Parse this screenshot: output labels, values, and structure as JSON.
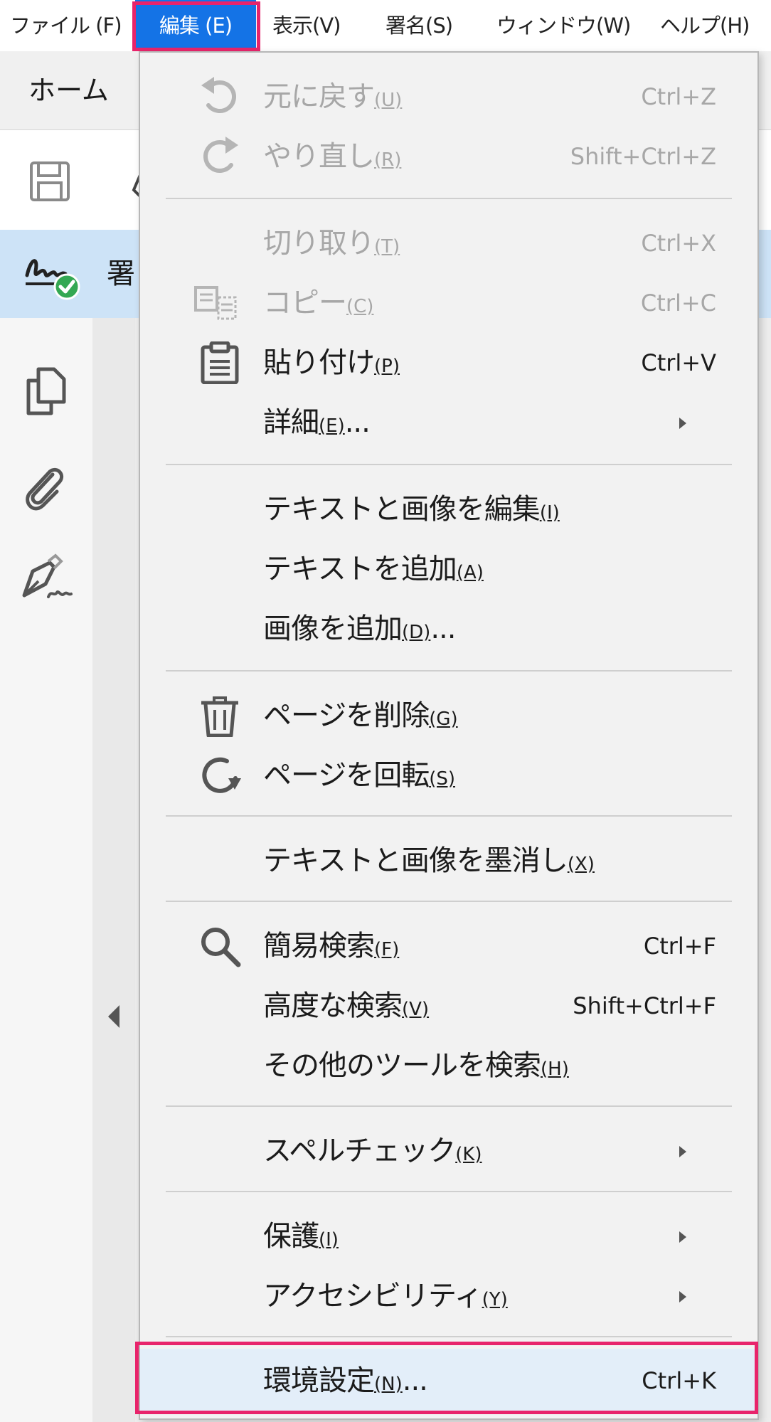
{
  "menubar": {
    "items": [
      {
        "label": "ファイル (F)"
      },
      {
        "label": "編集 (E)"
      },
      {
        "label": "表示(V)"
      },
      {
        "label": "署名(S)"
      },
      {
        "label": "ウィンドウ(W)"
      },
      {
        "label": "ヘルプ(H)"
      }
    ],
    "active_index": 1
  },
  "app": {
    "home_tab_label": "ホーム",
    "sign_bar_text": "署"
  },
  "edit_menu": {
    "items": [
      {
        "label": "元に戻す",
        "mnemonic": "(U)",
        "shortcut": "Ctrl+Z",
        "disabled": true,
        "icon": "undo-icon"
      },
      {
        "label": "やり直し",
        "mnemonic": "(R)",
        "shortcut": "Shift+Ctrl+Z",
        "disabled": true,
        "icon": "redo-icon"
      },
      {
        "label": "切り取り",
        "mnemonic": "(T)",
        "shortcut": "Ctrl+X",
        "disabled": true
      },
      {
        "label": "コピー",
        "mnemonic": "(C)",
        "shortcut": "Ctrl+C",
        "disabled": true,
        "icon": "copy-icon"
      },
      {
        "label": "貼り付け",
        "mnemonic": "(P)",
        "shortcut": "Ctrl+V",
        "disabled": false,
        "icon": "clipboard-icon"
      },
      {
        "label": "詳細",
        "mnemonic": "(E)",
        "suffix": "...",
        "submenu": true
      },
      {
        "label": "テキストと画像を編集",
        "mnemonic": "(I)"
      },
      {
        "label": "テキストを追加",
        "mnemonic": "(A)"
      },
      {
        "label": "画像を追加",
        "mnemonic": "(D)",
        "suffix": "..."
      },
      {
        "label": "ページを削除",
        "mnemonic": "(G)",
        "icon": "trash-icon"
      },
      {
        "label": "ページを回転",
        "mnemonic": "(S)",
        "icon": "rotate-icon"
      },
      {
        "label": "テキストと画像を墨消し",
        "mnemonic": "(X)"
      },
      {
        "label": "簡易検索",
        "mnemonic": "(F)",
        "shortcut": "Ctrl+F",
        "icon": "search-icon"
      },
      {
        "label": "高度な検索",
        "mnemonic": "(V)",
        "shortcut": "Shift+Ctrl+F"
      },
      {
        "label": "その他のツールを検索",
        "mnemonic": "(H)"
      },
      {
        "label": "スペルチェック",
        "mnemonic": "(K)",
        "submenu": true
      },
      {
        "label": "保護",
        "mnemonic": "(I)",
        "submenu": true
      },
      {
        "label": "アクセシビリティ",
        "mnemonic": "(Y)",
        "submenu": true
      },
      {
        "label": "環境設定",
        "mnemonic": "(N)",
        "suffix": "...",
        "shortcut": "Ctrl+K",
        "highlighted": true
      }
    ]
  },
  "colors": {
    "accent_blue": "#1473e6",
    "highlight_box": "#e8246b",
    "menu_background": "#f2f2f2",
    "selection_background": "#e3eef9",
    "sign_bar": "#cde3f7",
    "signed_check": "#34a853"
  }
}
